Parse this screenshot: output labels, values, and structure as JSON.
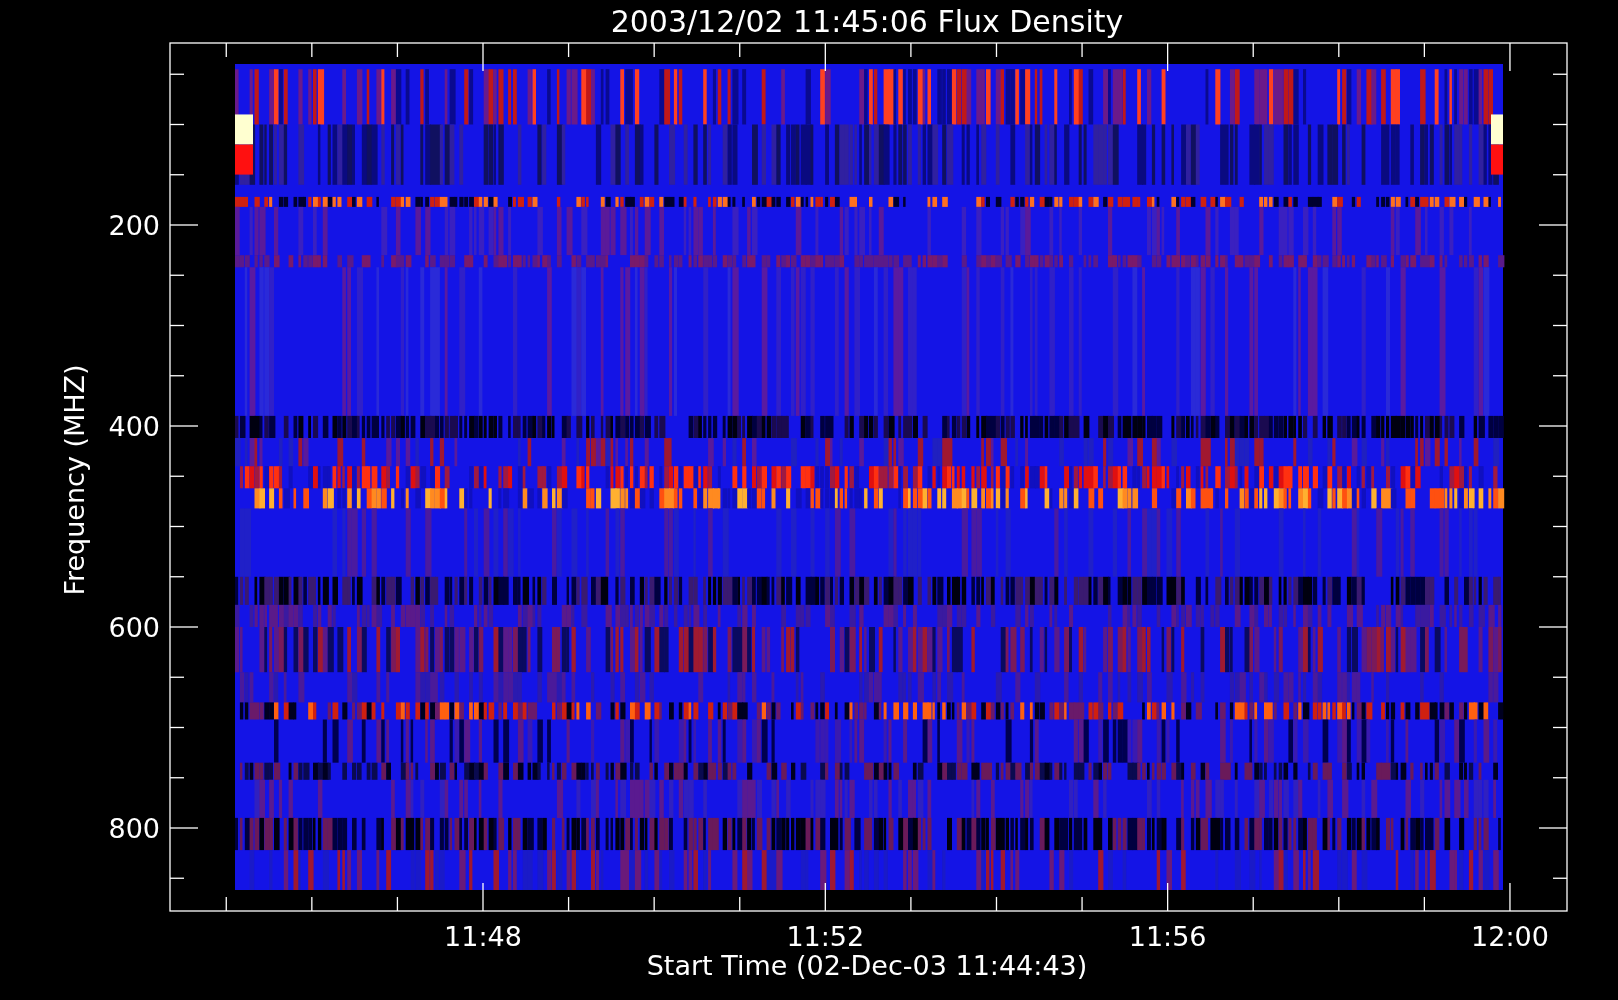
{
  "title": "2003/12/02 11:45:06 Flux Density",
  "y_axis": {
    "label": "Frequency (MHZ)",
    "ticks": [
      "200",
      "400",
      "600",
      "800"
    ]
  },
  "x_axis": {
    "label": "Start Time (02-Dec-03 11:44:43)",
    "ticks": [
      "11:48",
      "11:52",
      "11:56",
      "12:00"
    ]
  }
}
